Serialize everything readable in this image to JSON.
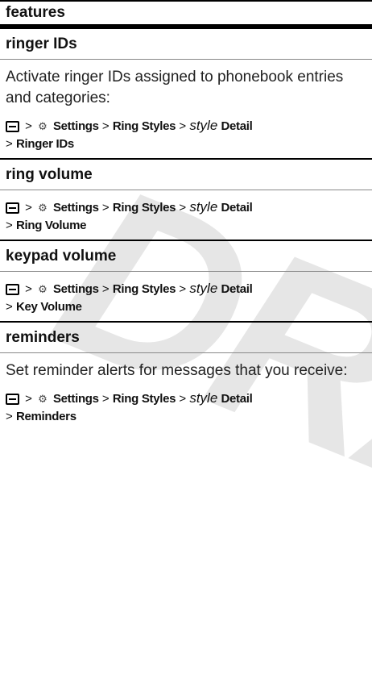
{
  "header": {
    "title": "features"
  },
  "sections": [
    {
      "title": "ringer IDs",
      "description": "Activate ringer IDs assigned to phonebook entries and categories:",
      "path": {
        "settings": "Settings",
        "ring_styles": "Ring Styles",
        "style": "style",
        "detail": "Detail",
        "item": "Ringer IDs"
      }
    },
    {
      "title": "ring volume",
      "description": "",
      "path": {
        "settings": "Settings",
        "ring_styles": "Ring Styles",
        "style": "style",
        "detail": "Detail",
        "item": "Ring Volume"
      }
    },
    {
      "title": "keypad volume",
      "description": "",
      "path": {
        "settings": "Settings",
        "ring_styles": "Ring Styles",
        "style": "style",
        "detail": "Detail",
        "item": "Key Volume"
      }
    },
    {
      "title": "reminders",
      "description": "Set reminder alerts for messages that you receive:",
      "path": {
        "settings": "Settings",
        "ring_styles": "Ring Styles",
        "style": "style",
        "detail": "Detail",
        "item": "Reminders"
      }
    }
  ],
  "watermark": "DRAFT",
  "separator": ">",
  "icons": {
    "menu_key": "menu-key-icon",
    "settings": "settings-icon"
  }
}
